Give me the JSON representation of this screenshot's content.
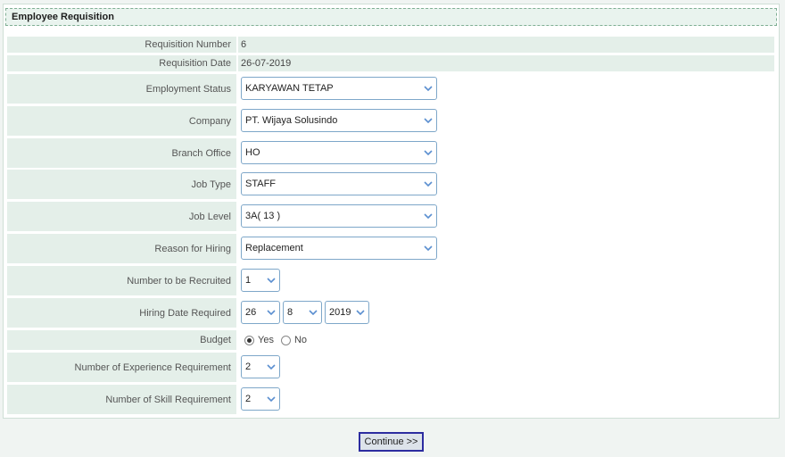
{
  "form": {
    "title": "Employee Requisition",
    "requisition_number": {
      "label": "Requisition Number",
      "value": "6"
    },
    "requisition_date": {
      "label": "Requisition Date",
      "value": "26-07-2019"
    },
    "employment_status": {
      "label": "Employment Status",
      "value": "KARYAWAN TETAP"
    },
    "company": {
      "label": "Company",
      "value": "PT. Wijaya Solusindo"
    },
    "branch_office": {
      "label": "Branch Office",
      "value": "HO"
    },
    "job_type": {
      "label": "Job Type",
      "value": "STAFF"
    },
    "job_level": {
      "label": "Job Level",
      "value": "3A( 13 )"
    },
    "reason_for_hiring": {
      "label": "Reason for Hiring",
      "value": "Replacement"
    },
    "number_to_recruit": {
      "label": "Number to be Recruited",
      "value": "1"
    },
    "hiring_date": {
      "label": "Hiring Date Required",
      "day": "26",
      "month": "8",
      "year": "2019"
    },
    "budget": {
      "label": "Budget",
      "yes_label": "Yes",
      "no_label": "No",
      "selected": "Yes"
    },
    "experience_requirement": {
      "label": "Number of Experience Requirement",
      "value": "2"
    },
    "skill_requirement": {
      "label": "Number of Skill Requirement",
      "value": "2"
    }
  },
  "actions": {
    "continue_label": "Continue >>"
  },
  "colors": {
    "chevron": "#5b8fd0",
    "label_bg": "#e4efe9",
    "select_border": "#7ea7c9",
    "button_border": "#2c2ca0"
  },
  "icons": {
    "dropdown": "chevron-down-icon"
  }
}
